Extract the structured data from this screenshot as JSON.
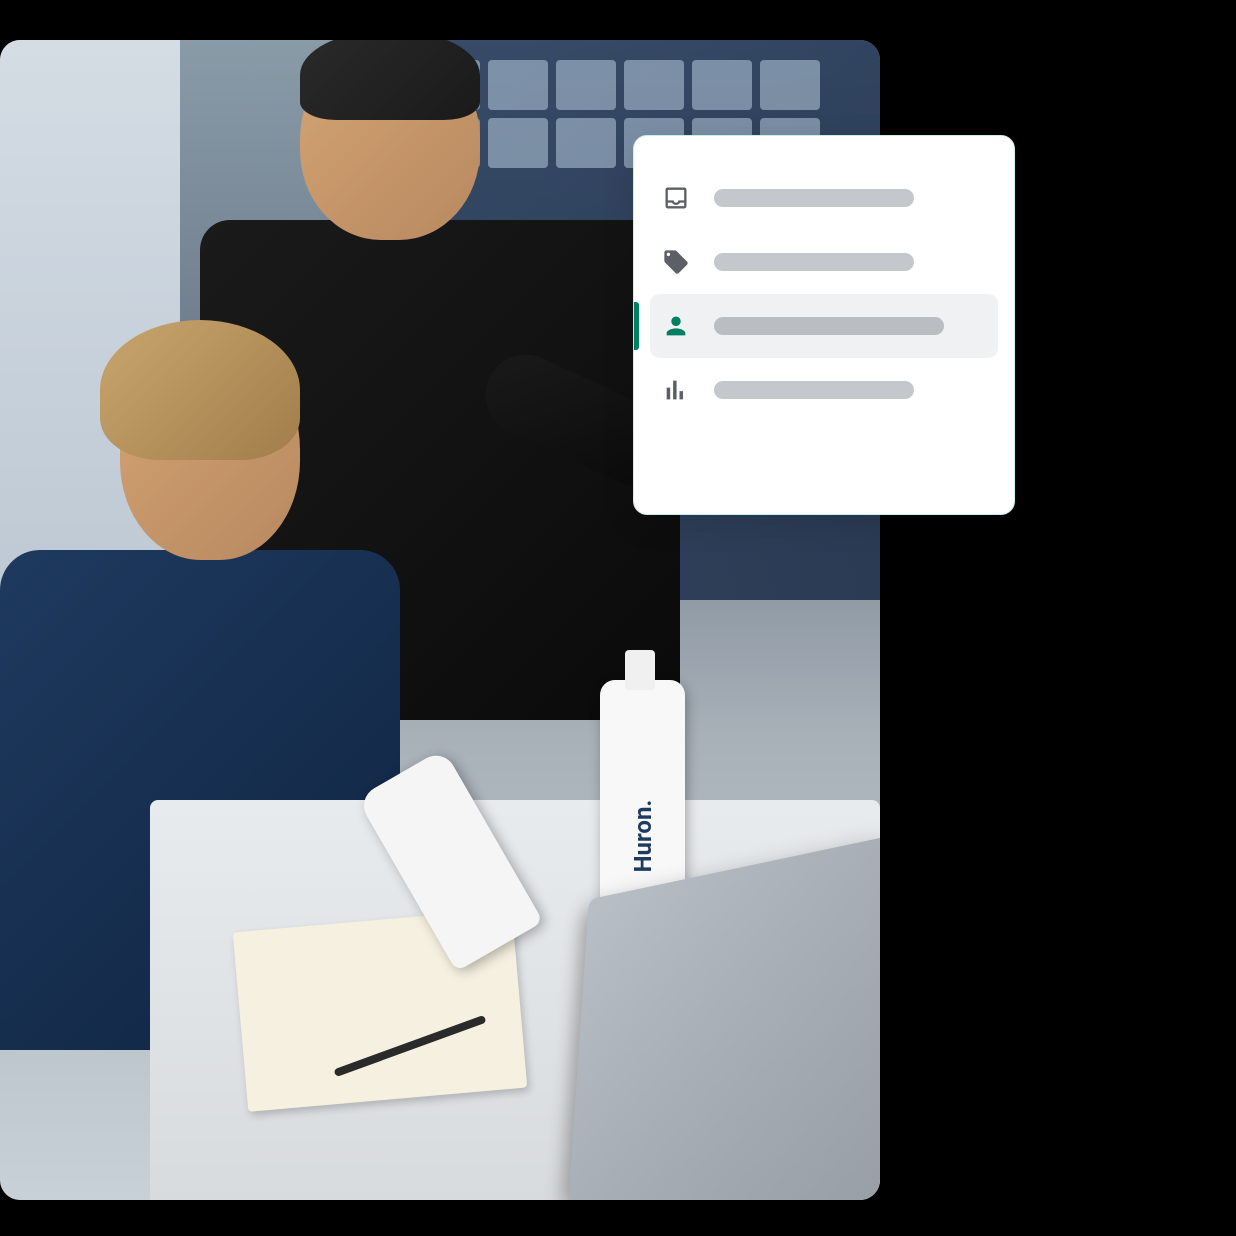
{
  "photo": {
    "product_brand": "Huron."
  },
  "nav_panel": {
    "items": [
      {
        "icon": "inbox-icon",
        "selected": false
      },
      {
        "icon": "tag-icon",
        "selected": false
      },
      {
        "icon": "person-icon",
        "selected": true
      },
      {
        "icon": "analytics-icon",
        "selected": false
      }
    ]
  },
  "colors": {
    "accent": "#008060",
    "placeholder": "#c4c8cc",
    "selected_bg": "#f0f1f2"
  }
}
